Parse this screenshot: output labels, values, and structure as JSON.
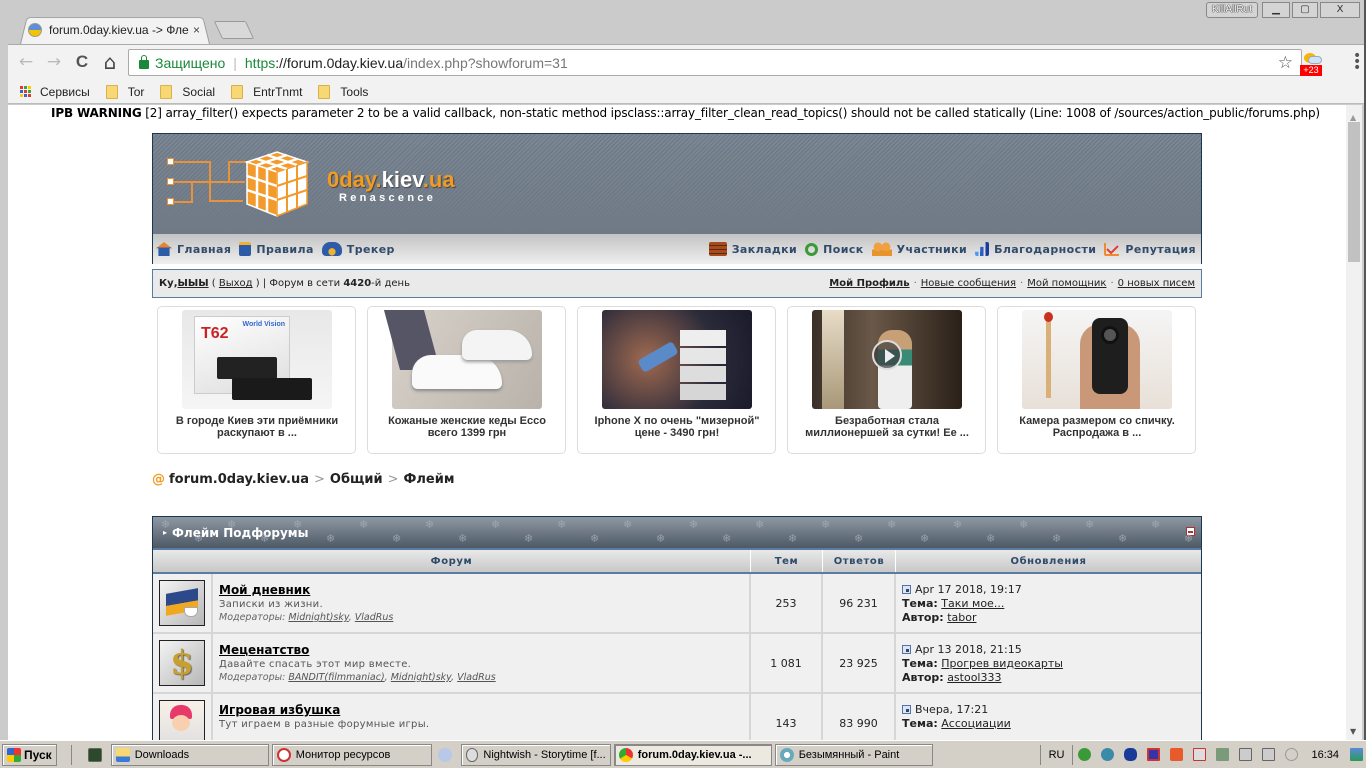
{
  "window": {
    "user_badge": "KillAllRut",
    "minimize": "▁",
    "maximize": "▢",
    "close": "X"
  },
  "tab": {
    "title": "forum.0day.kiev.ua -> Фле",
    "close": "×"
  },
  "toolbar": {
    "back": "←",
    "forward": "→",
    "reload": "C",
    "home": "⌂",
    "secure_label": "Защищено",
    "url_scheme": "https",
    "url_host": "://forum.0day.kiev.ua",
    "url_path": "/index.php?showforum=31",
    "star": "☆",
    "weather_temp": "+23",
    "menu": "⋮"
  },
  "bookmarks": [
    {
      "label": "Сервисы",
      "icon": "apps-icon"
    },
    {
      "label": "Tor",
      "icon": "folder-icon"
    },
    {
      "label": "Social",
      "icon": "folder-icon"
    },
    {
      "label": "EntrTnmt",
      "icon": "folder-icon"
    },
    {
      "label": "Tools",
      "icon": "folder-icon"
    }
  ],
  "warning": {
    "prefix": "IPB WARNING",
    "text": " [2] array_filter() expects parameter 2 to be a valid callback, non-static method ipsclass::array_filter_clean_read_topics() should not be called statically (Line: 1008 of /sources/action_public/forums.php)"
  },
  "logo": {
    "name_a": "0day.",
    "name_b": "kiev",
    "name_c": ".ua",
    "subtitle": "Renascence"
  },
  "nav": {
    "left": [
      {
        "label": "Главная",
        "icon": "home-icon",
        "color": "#e8842c"
      },
      {
        "label": "Правила",
        "icon": "rules-book-icon",
        "color": "#2c5ca8"
      },
      {
        "label": "Трекер",
        "icon": "tracker-cloud-icon",
        "color": "#2c5ca8"
      }
    ],
    "right": [
      {
        "label": "Закладки",
        "icon": "bookmarks-stack-icon",
        "color": "#a84a1c"
      },
      {
        "label": "Поиск",
        "icon": "search-icon",
        "color": "#3a9a3a"
      },
      {
        "label": "Участники",
        "icon": "members-icon",
        "color": "#e8942c"
      },
      {
        "label": "Благодарности",
        "icon": "thanks-chart-icon",
        "color": "#2c5cc8"
      },
      {
        "label": "Репутация",
        "icon": "reputation-chart-icon",
        "color": "#e84a2c"
      }
    ]
  },
  "userbar": {
    "greeting": "Ку, ",
    "username": "ЫЫЫ",
    "logout_open": " ( ",
    "logout": "Выход",
    "logout_close": " ) | Форум в сети ",
    "days": "4420",
    "days_suffix": "-й день",
    "links": [
      "Мой Профиль",
      "Новые сообщения",
      "Мой помощник",
      "0 новых писем"
    ],
    "dot": "·"
  },
  "ads": [
    {
      "text": "В городе Киев эти приёмники раскупают в ...",
      "image": "tv-receiver-photo"
    },
    {
      "text": "Кожаные женские кеды Ecco всего 1399 грн",
      "image": "white-sneakers-photo"
    },
    {
      "text": "Iphone X по очень \"мизерной\" цене - 3490 грн!",
      "image": "iphone-boxes-photo"
    },
    {
      "text": "Безработная стала миллионершей за сутки! Ее ...",
      "image": "woman-video-photo"
    },
    {
      "text": "Камера размером со спичку. Распродажа в ...",
      "image": "mini-camera-photo"
    }
  ],
  "breadcrumb": {
    "at": "@",
    "items": [
      "forum.0day.kiev.ua",
      "Общий",
      "Флейм"
    ],
    "sep": ">"
  },
  "forum_table": {
    "title": "Флейм Подфорумы",
    "columns": [
      "Форум",
      "Тем",
      "Ответов",
      "Обновления"
    ],
    "rows": [
      {
        "icon": "diary-book-icon",
        "name": "Мой дневник",
        "desc": "Записки из жизни.",
        "mods_label": "Модераторы:",
        "mods": [
          "Midnight)sky",
          "VladRus"
        ],
        "topics": "253",
        "replies": "96 231",
        "last_date": "Apr 17 2018, 19:17",
        "topic_label": "Тема:",
        "topic": "Таки мое...",
        "author_label": "Автор:",
        "author": "tabor"
      },
      {
        "icon": "dollar-sign-icon",
        "name": "Меценатство",
        "desc": "Давайте спасать этот мир вместе.",
        "mods_label": "Модераторы:",
        "mods": [
          "BANDIT(filmmaniac)",
          "Midnight)sky",
          "VladRus"
        ],
        "topics": "1 081",
        "replies": "23 925",
        "last_date": "Apr 13 2018, 21:15",
        "topic_label": "Тема:",
        "topic": "Прогрев видеокарты",
        "author_label": "Автор:",
        "author": "astool333"
      },
      {
        "icon": "game-character-icon",
        "name": "Игровая избушка",
        "desc": "Тут играем в разные форумные игры.",
        "mods_label": "",
        "mods": [],
        "topics": "143",
        "replies": "83 990",
        "last_date": "Вчера, 17:21",
        "topic_label": "Тема:",
        "topic": "Ассоциации",
        "author_label": "",
        "author": ""
      }
    ]
  },
  "taskbar": {
    "start": "Пуск",
    "items": [
      {
        "label": "Downloads",
        "active": false
      },
      {
        "label": "Монитор ресурсов",
        "active": false
      },
      {
        "label": "Nightwish - Storytime   [f...",
        "active": false
      },
      {
        "label": "forum.0day.kiev.ua -...",
        "active": true
      },
      {
        "label": "Безымянный - Paint",
        "active": false
      }
    ],
    "lang": "RU",
    "clock": "16:34"
  }
}
